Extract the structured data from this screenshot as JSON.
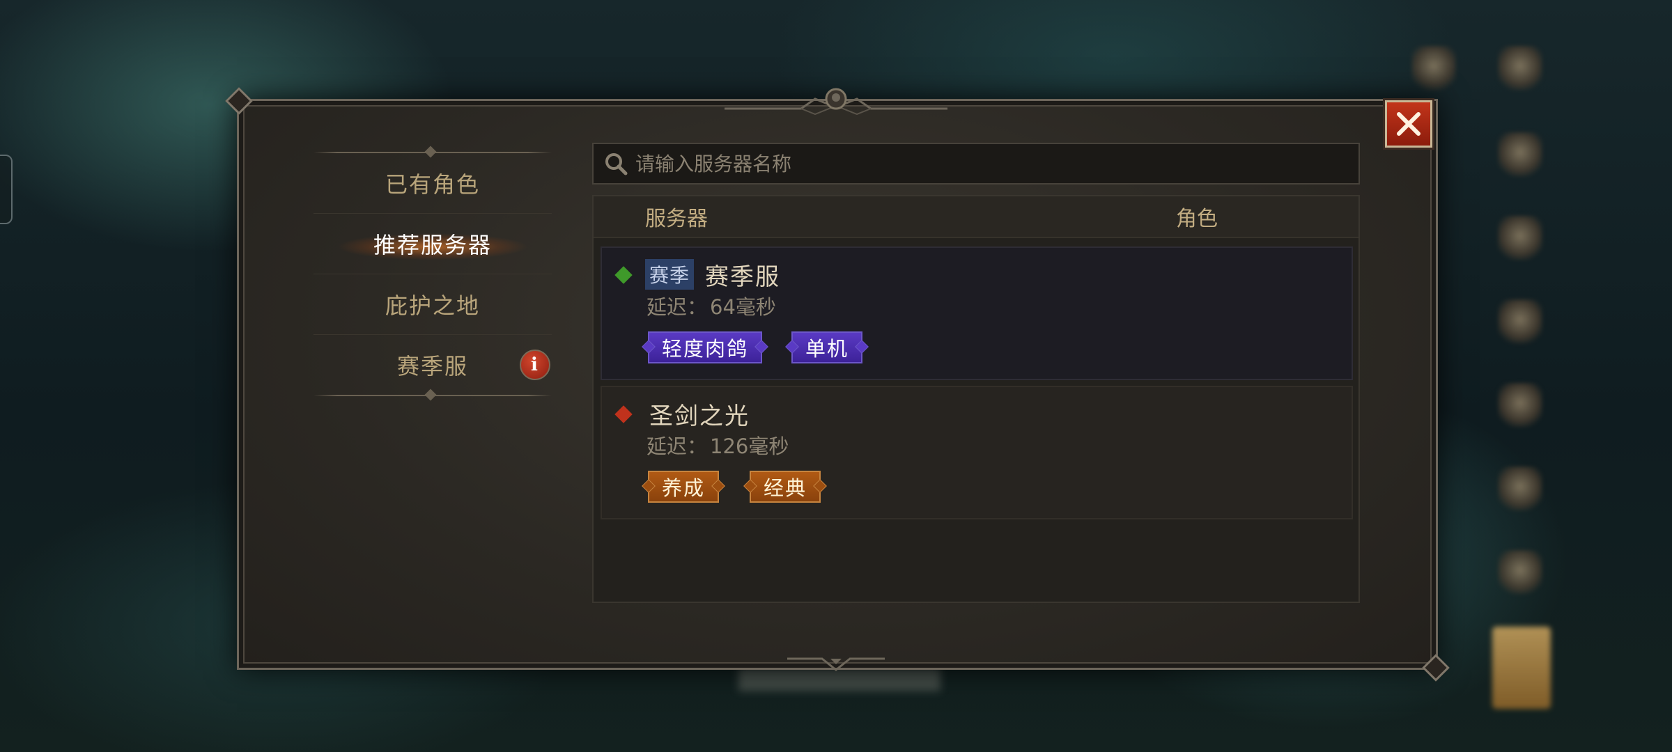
{
  "nav": {
    "items": [
      {
        "label": "已有角色",
        "active": false
      },
      {
        "label": "推荐服务器",
        "active": true
      },
      {
        "label": "庇护之地",
        "active": false
      },
      {
        "label": "赛季服",
        "active": false,
        "info": "i"
      }
    ]
  },
  "search": {
    "placeholder": "请输入服务器名称"
  },
  "table": {
    "headers": {
      "server": "服务器",
      "role": "角色"
    }
  },
  "servers": [
    {
      "season_badge": "赛季",
      "name": "赛季服",
      "status_color": "#3f9a2a",
      "latency_label": "延迟：",
      "latency_value": "64毫秒",
      "tags": [
        "轻度肉鸽",
        "单机"
      ]
    },
    {
      "name": "圣剑之光",
      "status_color": "#c0321c",
      "latency_label": "延迟：",
      "latency_value": "126毫秒",
      "tags": [
        "养成",
        "经典"
      ]
    }
  ],
  "colors": {
    "accent_orange": "#e07a28",
    "close_red": "#b02e16",
    "tag_purple": "#4b2db0",
    "tag_orange": "#a0520f"
  }
}
